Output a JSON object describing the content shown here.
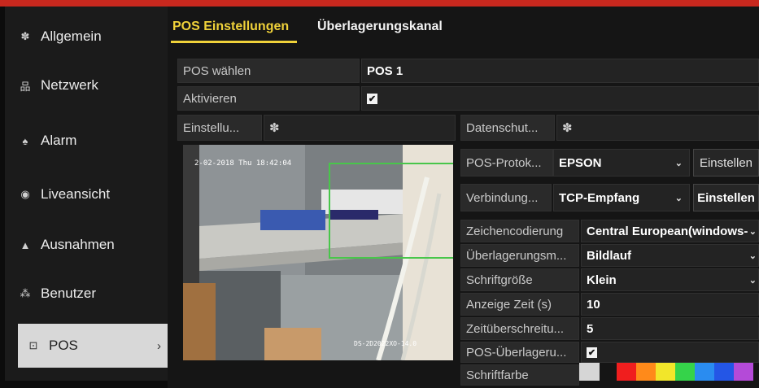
{
  "colors": {
    "accent": "#f0d23a",
    "overlay_box": "#48c64a"
  },
  "sidebar": {
    "items": [
      {
        "label": "Allgemein",
        "icon": "gear-icon",
        "glyph": "✽"
      },
      {
        "label": "Netzwerk",
        "icon": "network-icon",
        "glyph": "品"
      },
      {
        "label": "Alarm",
        "icon": "alarm-icon",
        "glyph": "♠"
      },
      {
        "label": "Liveansicht",
        "icon": "eye-icon",
        "glyph": "◉"
      },
      {
        "label": "Ausnahmen",
        "icon": "warning-icon",
        "glyph": "▲"
      },
      {
        "label": "Benutzer",
        "icon": "users-icon",
        "glyph": "⁂"
      },
      {
        "label": "POS",
        "icon": "pos-icon",
        "glyph": "⊡",
        "chevron": "›"
      }
    ]
  },
  "tabs": [
    {
      "label": "POS Einstellungen"
    },
    {
      "label": "Überlagerungskanal"
    }
  ],
  "form": {
    "pos_select": {
      "label": "POS wählen",
      "value": "POS 1"
    },
    "enable": {
      "label": "Aktivieren",
      "check": "✔"
    },
    "settings": {
      "label": "Einstellu...",
      "icon": "gear-icon",
      "glyph": "✽"
    },
    "privacy": {
      "label": "Datenschut...",
      "icon": "gear-icon",
      "glyph": "✽"
    },
    "protocol": {
      "label": "POS-Protok...",
      "value": "EPSON",
      "button": "Einstellen"
    },
    "connection": {
      "label": "Verbindung...",
      "value": "TCP-Empfang",
      "button": "Einstellen"
    },
    "encoding": {
      "label": "Zeichencodierung",
      "value": "Central European(windows-"
    },
    "overlay_mode": {
      "label": "Überlagerungsm...",
      "value": "Bildlauf"
    },
    "font_size": {
      "label": "Schriftgröße",
      "value": "Klein"
    },
    "display_time": {
      "label": "Anzeige Zeit (s)",
      "value": "10"
    },
    "timeout": {
      "label": "Zeitüberschreitu...",
      "value": "5"
    },
    "pos_overlay": {
      "label": "POS-Überlageru...",
      "check": "✔"
    },
    "font_color": {
      "label": "Schriftfarbe",
      "swatches": [
        "#d6d6d6",
        "#f01e1e",
        "#ff8a1a",
        "#f2e62a",
        "#35d34a",
        "#2a8cf0",
        "#2456e6",
        "#b44ad8"
      ]
    }
  },
  "preview": {
    "timestamp": "2-02-2018 Thu 18:42:04",
    "watermark": "DS-2D2022XO-14.0"
  },
  "dropdown_glyph": "⌄"
}
